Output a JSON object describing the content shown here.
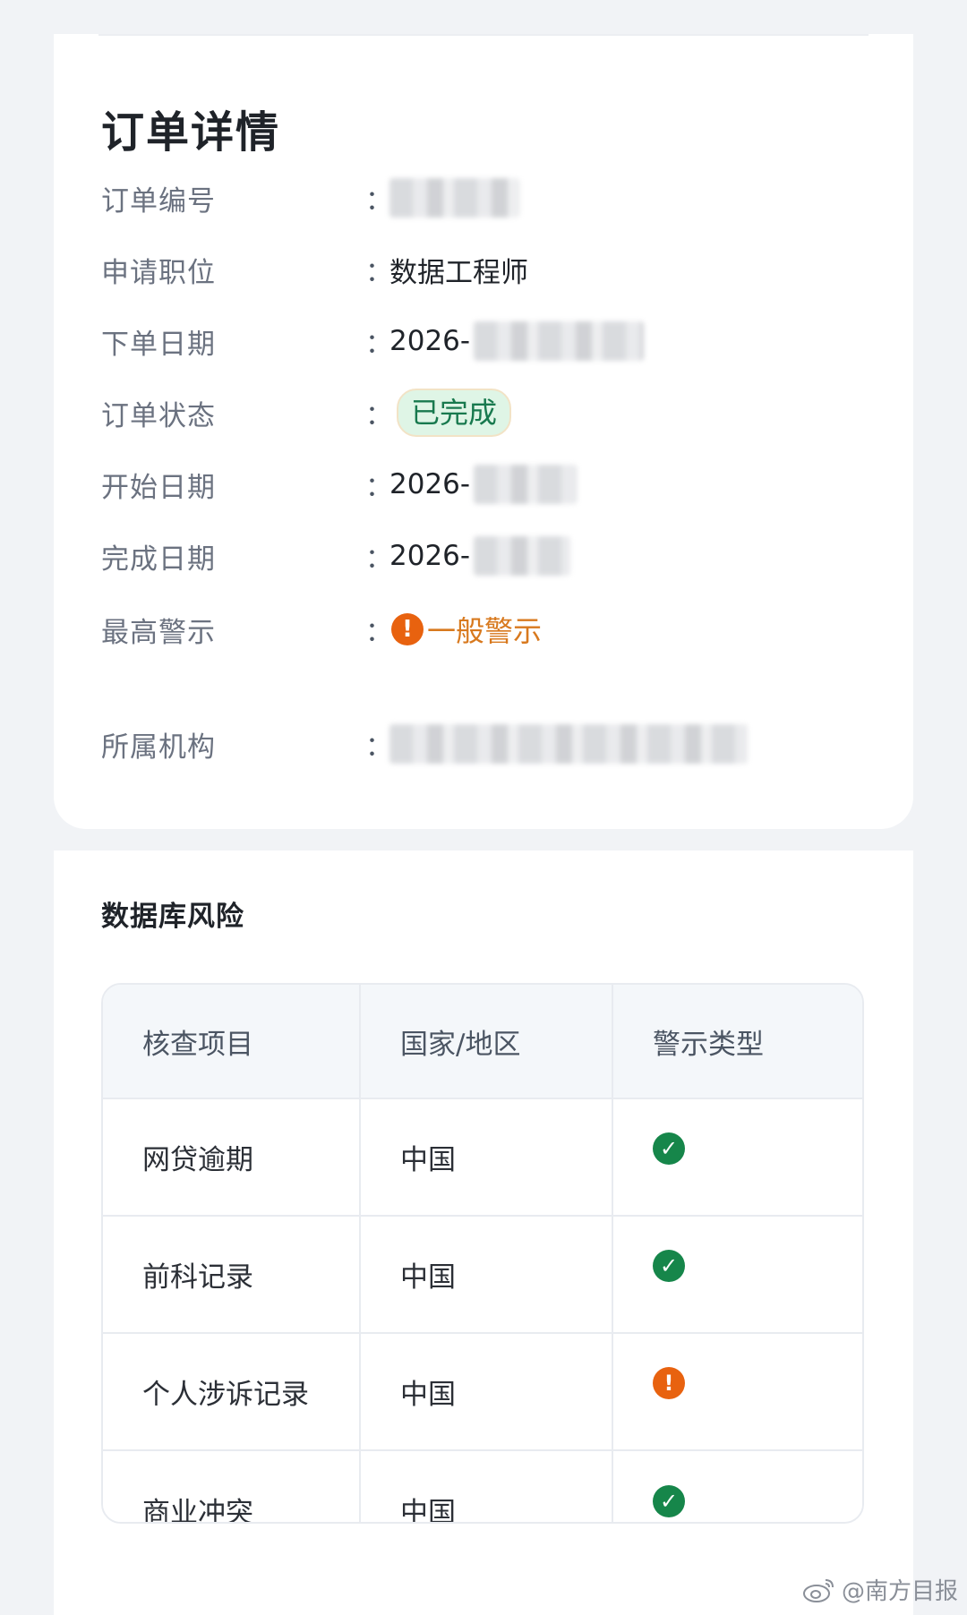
{
  "order": {
    "title": "订单详情",
    "rows": [
      {
        "label": "订单编号",
        "colon": "：",
        "value": ""
      },
      {
        "label": "申请职位",
        "colon": "：",
        "value": "数据工程师"
      },
      {
        "label": "下单日期",
        "colon": "：",
        "value": "2026-"
      },
      {
        "label": "订单状态",
        "colon": "：",
        "value": "已完成"
      },
      {
        "label": "开始日期",
        "colon": "：",
        "value": "2026-"
      },
      {
        "label": "完成日期",
        "colon": "：",
        "value": "2026-"
      },
      {
        "label": "最高警示",
        "colon": "：",
        "value": "一般警示"
      },
      {
        "label": "所属机构",
        "colon": "：",
        "value": ""
      }
    ],
    "status_color": "#18794e",
    "warning_color": "#e8620f"
  },
  "risk": {
    "title": "数据库风险",
    "headers": [
      "核查项目",
      "国家/地区",
      "警示类型"
    ],
    "rows": [
      {
        "item": "网贷逾期",
        "region": "中国",
        "status_icon": "check-circle-icon"
      },
      {
        "item": "前科记录",
        "region": "中国",
        "status_icon": "check-circle-icon"
      },
      {
        "item": "个人涉诉记录",
        "region": "中国",
        "status_icon": "alert-circle-icon"
      },
      {
        "item": "商业冲突",
        "region": "中国",
        "status_icon": "check-circle-icon"
      }
    ]
  },
  "watermark": {
    "text": "@南方目报"
  }
}
